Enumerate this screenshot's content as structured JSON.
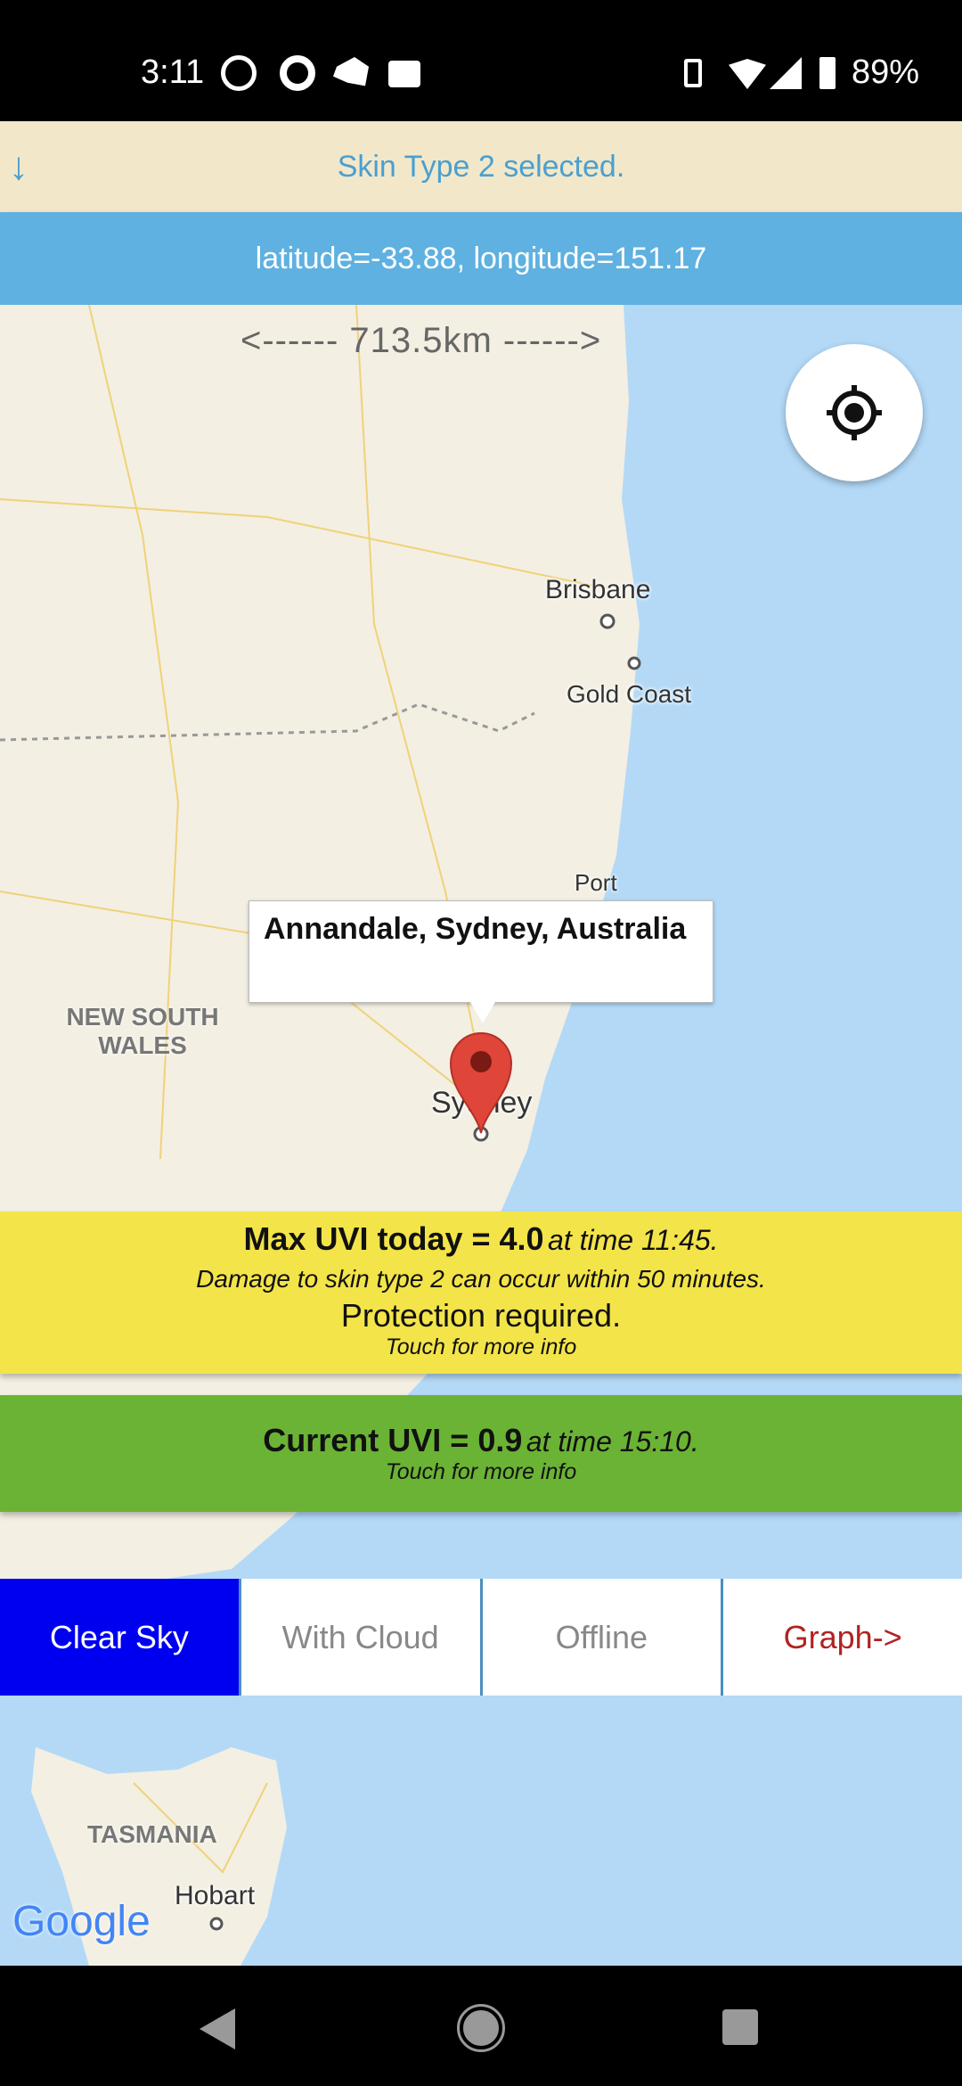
{
  "status_bar": {
    "time": "3:11",
    "battery": "89%",
    "icons": [
      "g-icon",
      "chrome-icon",
      "australia-news-icon",
      "ge-icon",
      "vibrate-icon",
      "wifi-icon",
      "signal-icon",
      "battery-icon"
    ]
  },
  "skin_banner": {
    "text": "Skin Type 2 selected.",
    "icon": "arrow-down-icon"
  },
  "location_bar": {
    "text": "latitude=-33.88, longitude=151.17"
  },
  "map": {
    "scale": "<------ 713.5km ------>",
    "labels": {
      "brisbane": "Brisbane",
      "gold_coast": "Gold Coast",
      "port": "Port",
      "nsw_1": "NEW SOUTH",
      "nsw_2": "WALES",
      "sydney": "Sydney",
      "tasmania": "TASMANIA",
      "hobart": "Hobart"
    },
    "info_window": "Annandale, Sydney, Australia",
    "logo": "Google"
  },
  "max_uv": {
    "title": "Max UVI today = 4.0",
    "time": "at time 11:45.",
    "damage": "Damage to skin type 2 can occur within 50 minutes.",
    "advice": "Protection required.",
    "hint": "Touch for more info",
    "color": "#f3e44a"
  },
  "current_uv": {
    "title": "Current UVI = 0.9",
    "time": "at time 15:10.",
    "hint": "Touch for more info",
    "color": "#6bb334"
  },
  "modes": [
    {
      "label": "Clear Sky",
      "selected": true,
      "color": "#ffffff"
    },
    {
      "label": "With Cloud",
      "color": "#888888"
    },
    {
      "label": "Offline",
      "color": "#888888"
    },
    {
      "label": "Graph->",
      "color": "#b22222"
    }
  ]
}
